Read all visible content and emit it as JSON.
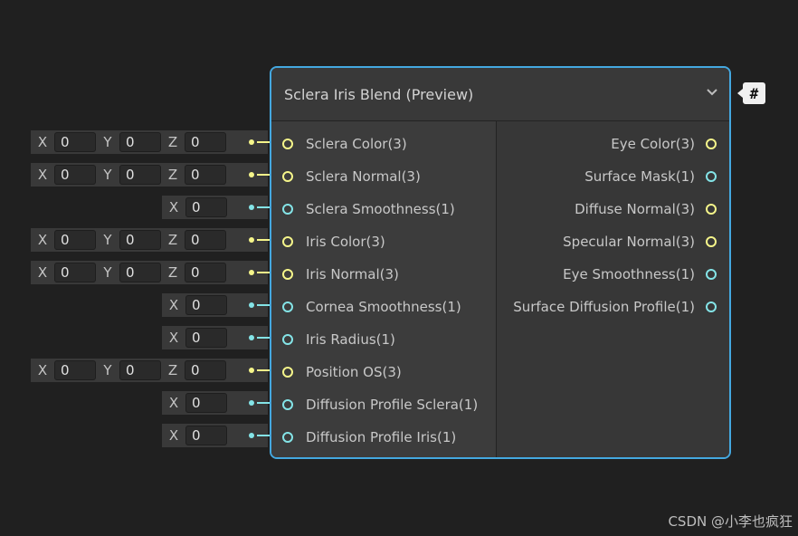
{
  "node": {
    "title": "Sclera Iris Blend (Preview)",
    "inputs": [
      {
        "label": "Sclera Color(3)",
        "type": "vec3"
      },
      {
        "label": "Sclera Normal(3)",
        "type": "vec3"
      },
      {
        "label": "Sclera Smoothness(1)",
        "type": "float"
      },
      {
        "label": "Iris Color(3)",
        "type": "vec3"
      },
      {
        "label": "Iris Normal(3)",
        "type": "vec3"
      },
      {
        "label": "Cornea Smoothness(1)",
        "type": "float"
      },
      {
        "label": "Iris Radius(1)",
        "type": "float"
      },
      {
        "label": "Position OS(3)",
        "type": "vec3"
      },
      {
        "label": "Diffusion Profile Sclera(1)",
        "type": "float"
      },
      {
        "label": "Diffusion Profile Iris(1)",
        "type": "float"
      }
    ],
    "outputs": [
      {
        "label": "Eye Color(3)",
        "type": "vec3"
      },
      {
        "label": "Surface Mask(1)",
        "type": "float"
      },
      {
        "label": "Diffuse Normal(3)",
        "type": "vec3"
      },
      {
        "label": "Specular Normal(3)",
        "type": "vec3"
      },
      {
        "label": "Eye Smoothness(1)",
        "type": "float"
      },
      {
        "label": "Surface Diffusion Profile(1)",
        "type": "float"
      }
    ]
  },
  "fields": [
    {
      "x": "0",
      "y": "0",
      "z": "0"
    },
    {
      "x": "0",
      "y": "0",
      "z": "0"
    },
    {
      "x": "0"
    },
    {
      "x": "0",
      "y": "0",
      "z": "0"
    },
    {
      "x": "0",
      "y": "0",
      "z": "0"
    },
    {
      "x": "0"
    },
    {
      "x": "0"
    },
    {
      "x": "0",
      "y": "0",
      "z": "0"
    },
    {
      "x": "0"
    },
    {
      "x": "0"
    }
  ],
  "axis_labels": {
    "x": "X",
    "y": "Y",
    "z": "Z"
  },
  "badge": {
    "text": "#",
    "icon": "hash-icon"
  },
  "watermark": "CSDN @小李也疯狂",
  "colors": {
    "vec3": "#f5f58a",
    "float": "#84e4e7",
    "border": "#44a8e0"
  }
}
